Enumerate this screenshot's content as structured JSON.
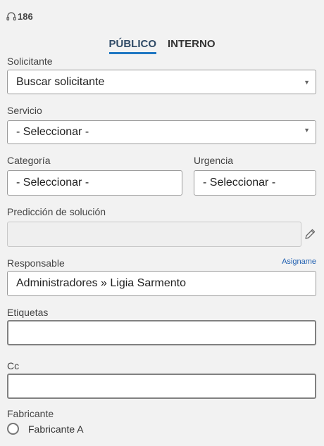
{
  "ticket": {
    "number": "186",
    "icon": "headset-icon"
  },
  "tabs": [
    {
      "label": "PÚBLICO",
      "active": true
    },
    {
      "label": "INTERNO",
      "active": false
    }
  ],
  "form": {
    "solicitante": {
      "label": "Solicitante",
      "value": "Buscar solicitante"
    },
    "servicio": {
      "label": "Servicio",
      "value": "- Seleccionar -"
    },
    "categoria": {
      "label": "Categoría",
      "value": "- Seleccionar -"
    },
    "urgencia": {
      "label": "Urgencia",
      "value": "- Seleccionar -"
    },
    "prediccion": {
      "label": "Predicción de solución",
      "value": ""
    },
    "responsable": {
      "label": "Responsable",
      "value": "Administradores » Ligia Sarmento",
      "action_label": "Asigname"
    },
    "etiquetas": {
      "label": "Etiquetas",
      "value": ""
    },
    "cc": {
      "label": "Cc",
      "value": ""
    },
    "fabricante": {
      "label": "Fabricante",
      "option": "Fabricante A"
    }
  },
  "colors": {
    "accent": "#1f77c2",
    "link": "#1f5fb0",
    "background": "#f2f2f2"
  }
}
